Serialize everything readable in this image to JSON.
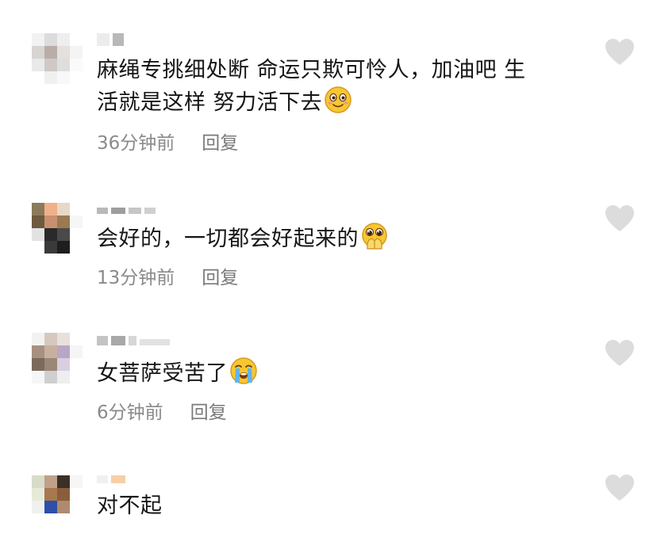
{
  "comments": [
    {
      "text_line1": "麻绳专挑细处断 命运只欺可怜人，加油吧 生",
      "text_line2": "活就是这样 努力活下去",
      "emoji": "blushing-smile-emoji",
      "time": "36分钟前",
      "reply": "回复"
    },
    {
      "text": "会好的，一切都会好起来的",
      "emoji": "pleading-hands-emoji",
      "time": "13分钟前",
      "reply": "回复"
    },
    {
      "text": "女菩萨受苦了",
      "emoji": "loudly-crying-emoji",
      "time": "6分钟前",
      "reply": "回复"
    },
    {
      "text": "对不起"
    }
  ],
  "icons": {
    "like": "heart-icon"
  },
  "colors": {
    "text": "#161616",
    "meta": "#8a8a8a",
    "heart": "#dcdcdc",
    "emoji_yellow": "#f7c733"
  }
}
